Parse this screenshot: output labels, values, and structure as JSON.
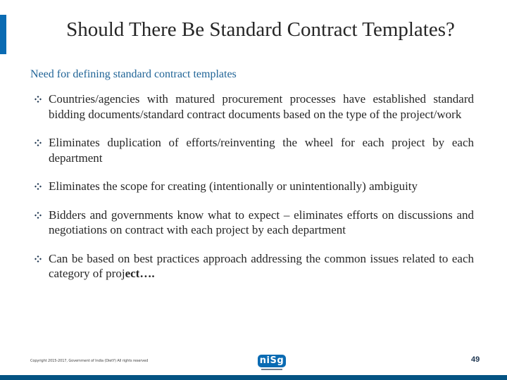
{
  "slide": {
    "title": "Should There Be Standard Contract Templates?",
    "subheading": "Need for defining standard contract templates",
    "bullet_icon": "four-diamond-bullet-icon",
    "bullets": [
      {
        "text": "Countries/agencies with matured procurement processes have established standard bidding documents/standard contract documents based on the type of the project/work",
        "emphasis": ""
      },
      {
        "text": "Eliminates duplication of efforts/reinventing the wheel for each project by each department",
        "emphasis": ""
      },
      {
        "text": "Eliminates the scope for creating (intentionally or unintentionally) ambiguity",
        "emphasis": ""
      },
      {
        "text": "Bidders and governments know what to expect – eliminates efforts on discussions and negotiations on contract with each project by each department",
        "emphasis": ""
      },
      {
        "text": "Can be based on best practices approach addressing the common issues related to each category of proj",
        "emphasis": "ect…."
      }
    ]
  },
  "footer": {
    "copyright": "Copyright 2015-2017, Government of India (DietY) All rights reserved",
    "logo_text": "niSg",
    "page_number": "49"
  },
  "colors": {
    "accent": "#0a6bb3",
    "subheading": "#1f6396",
    "body_text": "#262626",
    "bottom_band": "#045383"
  }
}
